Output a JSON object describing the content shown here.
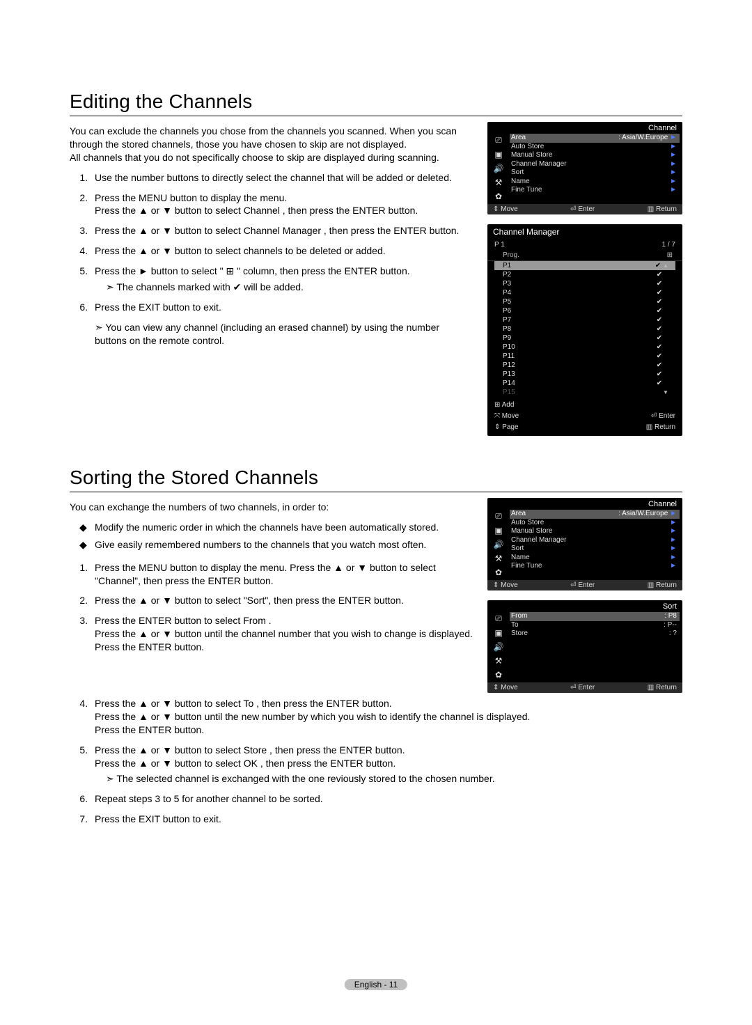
{
  "glyph": {
    "up": "▲",
    "down": "▼",
    "left": "◀",
    "right": "►",
    "updown": "⇕",
    "check": "✔",
    "plus": "⊞",
    "enter": "⏎",
    "return": "▥"
  },
  "section1": {
    "title": "Editing the Channels",
    "intro": "You can exclude the channels you chose from the channels you scanned. When you scan through the stored channels, those you have chosen to skip are not displayed.\nAll channels that you do not specifically choose to skip are displayed during scanning.",
    "steps": [
      {
        "text": "Use the number buttons to directly select the channel that will be added or deleted."
      },
      {
        "text": "Press the MENU button to display the menu.\nPress the ▲ or ▼ button to select  Channel , then press the ENTER button."
      },
      {
        "text": "Press the ▲ or ▼ button to select  Channel Manager , then press the ENTER button."
      },
      {
        "text": "Press the ▲ or ▼ button to select channels to be deleted or added."
      },
      {
        "text": "Press the ► button to select \" ⊞ \" column, then press the ENTER button.",
        "note": "The channels marked with   ✔   will be added."
      },
      {
        "text": "Press the EXIT button to exit."
      }
    ],
    "tail_note": "You can view any channel (including an erased channel) by using the number buttons on the remote control."
  },
  "section2": {
    "title": "Sorting the Stored Channels",
    "intro": "You can exchange the numbers of two channels, in order to:",
    "bullets": [
      "Modify the numeric order in which the channels have been automatically stored.",
      "Give easily remembered numbers to the channels that you watch most often."
    ],
    "steps": [
      {
        "text": "Press the MENU button to display the menu.  Press the ▲ or ▼ button to select \"Channel\", then press the ENTER button."
      },
      {
        "text": "Press the ▲ or ▼ button to select \"Sort\", then press the ENTER button."
      },
      {
        "text": "Press the ENTER button to select  From .\nPress the ▲ or ▼ button until the channel number that you wish to change is displayed.\nPress the ENTER button."
      },
      {
        "text": "Press the ▲ or ▼ button to select  To , then press the ENTER button.\nPress the ▲ or ▼ button until the new number by which you wish to identify the channel is displayed.\nPress the ENTER button."
      },
      {
        "text": "Press the ▲ or ▼ button to select  Store , then press the  ENTER  button.\nPress the ▲ or ▼ button to select  OK , then press the ENTER button.",
        "note": "The selected channel is exchanged with the one reviously stored to the chosen number."
      },
      {
        "text": "Repeat steps 3 to 5 for another channel to be sorted."
      },
      {
        "text": "Press the EXIT button to exit."
      }
    ]
  },
  "osd_channel": {
    "title": "Channel",
    "rows": [
      {
        "label": "Area",
        "value": ": Asia/W.Europe",
        "arrow": true,
        "hl": true
      },
      {
        "label": "Auto Store",
        "value": "",
        "arrow": true
      },
      {
        "label": "Manual Store",
        "value": "",
        "arrow": true
      },
      {
        "label": "Channel Manager",
        "value": "",
        "arrow": true
      },
      {
        "label": "Sort",
        "value": "",
        "arrow": true
      },
      {
        "label": "Name",
        "value": "",
        "arrow": true
      },
      {
        "label": "Fine Tune",
        "value": "",
        "arrow": true
      }
    ],
    "footer": {
      "move": "Move",
      "enter": "Enter",
      "return": "Return"
    }
  },
  "channel_manager": {
    "title": "Channel Manager",
    "sub_left": "P 1",
    "sub_right": "1 / 7",
    "header_left": "Prog.",
    "header_right_icon": "⊞",
    "rows": [
      "P1",
      "P2",
      "P3",
      "P4",
      "P5",
      "P6",
      "P7",
      "P8",
      "P9",
      "P10",
      "P11",
      "P12",
      "P13",
      "P14",
      "P15"
    ],
    "dim_last": true,
    "add": "Add",
    "footer": {
      "move": "Move",
      "enter": "Enter",
      "page": "Page",
      "return": "Return"
    }
  },
  "osd_sort": {
    "title": "Sort",
    "rows": [
      {
        "label": "From",
        "value": ": P8",
        "hl": true
      },
      {
        "label": "To",
        "value": ": P--"
      },
      {
        "label": "Store",
        "value": ": ?"
      }
    ],
    "footer": {
      "move": "Move",
      "enter": "Enter",
      "return": "Return"
    }
  },
  "footer": {
    "lang": "English - 11"
  }
}
